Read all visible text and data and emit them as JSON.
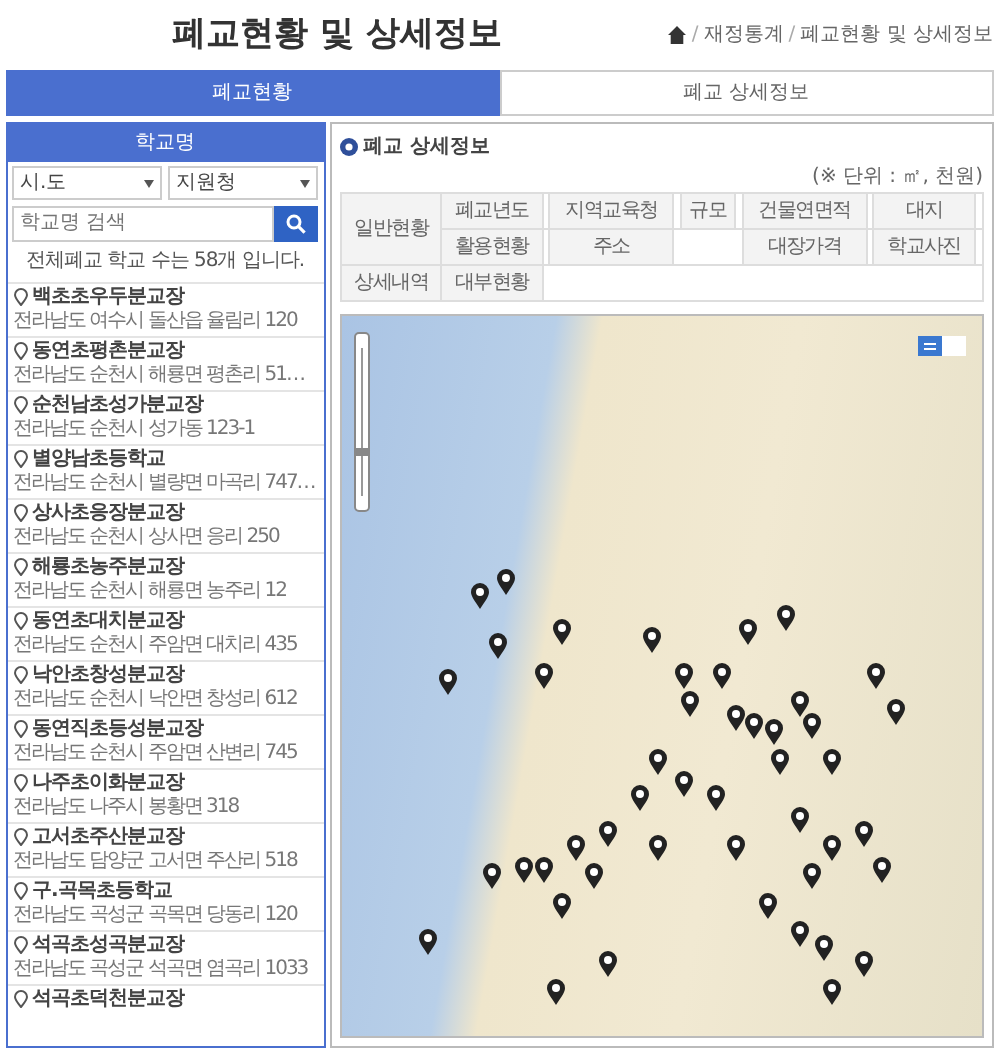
{
  "page_title": "폐교현황 및 상세정보",
  "breadcrumb": [
    {
      "kind": "separator",
      "text": "/"
    },
    {
      "kind": "link",
      "text": "재정통계"
    },
    {
      "kind": "separator",
      "text": "/"
    },
    {
      "kind": "link",
      "text": "폐교현황 및 상세정보"
    }
  ],
  "tabs": [
    {
      "label": "폐교현황",
      "selected": true
    },
    {
      "label": "폐교 상세정보",
      "selected": false
    }
  ],
  "sidebar": {
    "title": "학교명",
    "selects": [
      "시.도",
      "지원청"
    ],
    "search": {
      "placeholder": "학교명 검색"
    },
    "count_text": "전체폐교 학교 수는 58개 입니다.",
    "schools": [
      {
        "name": "백초초우두분교장",
        "address": "전라남도 여수시 돌산읍 율림리 120"
      },
      {
        "name": "동연초평촌분교장",
        "address": "전라남도 순천시 해룡면 평촌리 51…"
      },
      {
        "name": "순천남초성가분교장",
        "address": "전라남도 순천시 성가동 123-1"
      },
      {
        "name": "별양남초등학교",
        "address": "전라남도 순천시 별량면 마곡리 747…"
      },
      {
        "name": "상사초응장분교장",
        "address": "전라남도 순천시 상사면 응리 250"
      },
      {
        "name": "해룡초농주분교장",
        "address": "전라남도 순천시 해룡면 농주리 12"
      },
      {
        "name": "동연초대치분교장",
        "address": "전라남도 순천시 주암면 대치리 435"
      },
      {
        "name": "낙안초창성분교장",
        "address": "전라남도 순천시 낙안면 창성리 612"
      },
      {
        "name": "동연직초등성분교장",
        "address": "전라남도 순천시 주암면 산변리 745"
      },
      {
        "name": "나주초이화분교장",
        "address": "전라남도 나주시 봉황면 318"
      },
      {
        "name": "고서초주산분교장",
        "address": "전라남도 담양군 고서면 주산리 518"
      },
      {
        "name": "구.곡목초등학교",
        "address": "전라남도 곡성군 곡목면 당동리 120"
      },
      {
        "name": "석곡초성곡분교장",
        "address": "전라남도 곡성군 석곡면 염곡리 1033"
      },
      {
        "name": "석곡초덕천분교장"
      }
    ]
  },
  "detail": {
    "title": "폐교 상세정보",
    "unit_note": "(※ 단위 : ㎡, 천원)",
    "rows": [
      [
        {
          "text": "일반현황",
          "rowspan": 2
        },
        "폐교년도",
        "",
        "지역교육청",
        "",
        "규모",
        "",
        "건물연면적",
        "",
        "대지",
        ""
      ],
      [
        "활용현황",
        "",
        "주소",
        {
          "text": "",
          "colspan": 3
        },
        "대장가격",
        "",
        "학교사진",
        ""
      ],
      [
        "상세내역",
        "대부현황",
        {
          "text": "",
          "colspan": 9
        }
      ]
    ]
  }
}
